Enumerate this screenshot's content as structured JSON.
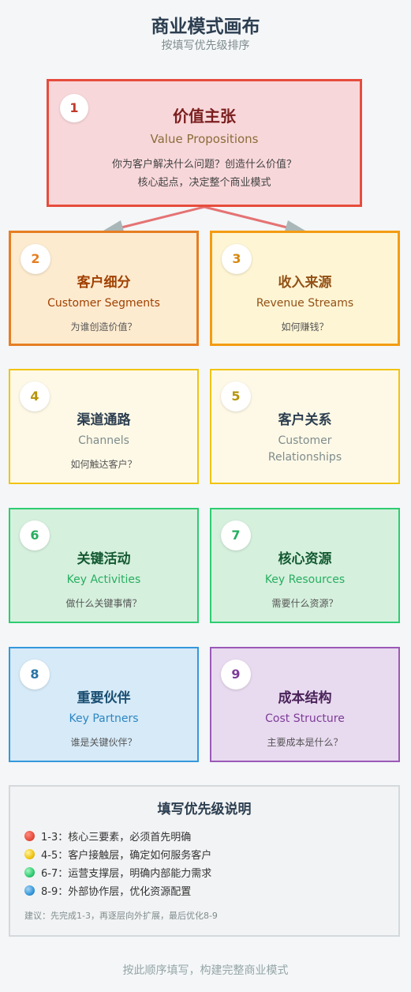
{
  "title": "商业模式画布",
  "subtitle": "按填写优先级排序",
  "cards": [
    {
      "num": "1",
      "cn": "价值主张",
      "en": "Value Propositions",
      "desc": [
        "你为客户解决什么问题？创造什么价值？",
        "核心起点，决定整个商业模式"
      ]
    },
    {
      "num": "2",
      "cn": "客户细分",
      "en": "Customer Segments",
      "desc": [
        "为谁创造价值？"
      ]
    },
    {
      "num": "3",
      "cn": "收入来源",
      "en": "Revenue Streams",
      "desc": [
        "如何赚钱？"
      ]
    },
    {
      "num": "4",
      "cn": "渠道通路",
      "en": "Channels",
      "desc": [
        "如何触达客户？"
      ]
    },
    {
      "num": "5",
      "cn": "客户关系",
      "en": "Customer Relationships",
      "desc": []
    },
    {
      "num": "6",
      "cn": "关键活动",
      "en": "Key Activities",
      "desc": [
        "做什么关键事情？"
      ]
    },
    {
      "num": "7",
      "cn": "核心资源",
      "en": "Key Resources",
      "desc": [
        "需要什么资源？"
      ]
    },
    {
      "num": "8",
      "cn": "重要伙伴",
      "en": "Key Partners",
      "desc": [
        "谁是关键伙伴？"
      ]
    },
    {
      "num": "9",
      "cn": "成本结构",
      "en": "Cost Structure",
      "desc": [
        "主要成本是什么？"
      ]
    }
  ],
  "notes": {
    "title": "填写优先级说明",
    "items": [
      {
        "text": "1-3：核心三要素，必须首先明确",
        "color": "#e74c3c"
      },
      {
        "text": "4-5：客户接触层，确定如何服务客户",
        "color": "#f1c40f"
      },
      {
        "text": "6-7：运营支撑层，明确内部能力需求",
        "color": "#2ecc71"
      },
      {
        "text": "8-9：外部协作层，优化资源配置",
        "color": "#3498db"
      }
    ],
    "tip": "建议：先完成1-3，再逐层向外扩展，最后优化8-9"
  },
  "footer": "按此顺序填写，构建完整商业模式",
  "colors": {
    "arrow": "#e57373",
    "arrowhead": "#aab7b8"
  }
}
